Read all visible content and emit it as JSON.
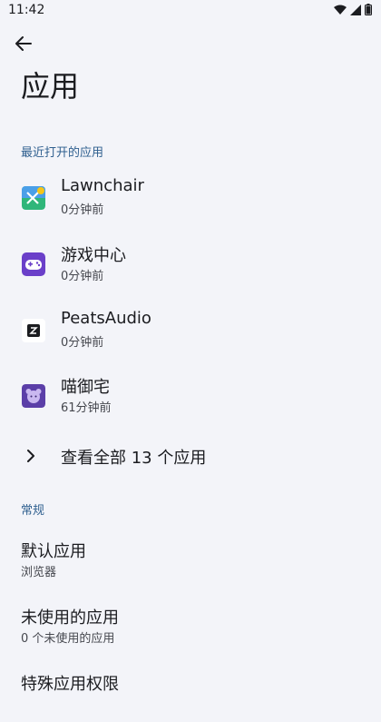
{
  "status_bar": {
    "time": "11:42",
    "icons": [
      "wifi-icon",
      "signal-icon",
      "battery-icon"
    ]
  },
  "header": {
    "back_icon": "arrow-back-icon",
    "title": "应用"
  },
  "recent": {
    "section_label": "最近打开的应用",
    "apps": [
      {
        "name": "Lawnchair",
        "time": "0分钟前",
        "icon": "lawnchair-icon"
      },
      {
        "name": "游戏中心",
        "time": "0分钟前",
        "icon": "game-center-icon"
      },
      {
        "name": "PeatsAudio",
        "time": "0分钟前",
        "icon": "peatsaudio-icon"
      },
      {
        "name": "喵御宅",
        "time": "61分钟前",
        "icon": "miao-yuzhai-icon"
      }
    ],
    "see_all_label": "查看全部 13 个应用"
  },
  "general": {
    "section_label": "常规",
    "items": [
      {
        "title": "默认应用",
        "subtitle": "浏览器"
      },
      {
        "title": "未使用的应用",
        "subtitle": "0 个未使用的应用"
      },
      {
        "title": "特殊应用权限",
        "subtitle": ""
      }
    ]
  },
  "colors": {
    "background": "#f3f4f9",
    "section_header": "#2f5f8f",
    "lawnchair": "#2fb67a",
    "game_center": "#6a3fc9",
    "miao": "#5b3fa8"
  }
}
